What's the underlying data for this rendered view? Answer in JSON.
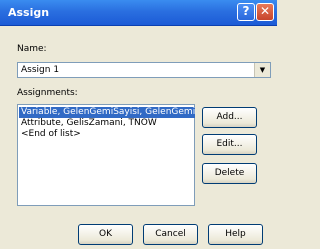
{
  "window": {
    "title": "Assign",
    "help_glyph": "?",
    "close_glyph": "✕"
  },
  "name_field": {
    "label": "Name:",
    "value": "Assign 1",
    "dropdown_glyph": "▼"
  },
  "assignments": {
    "label": "Assignments:",
    "items": [
      "Variable, GelenGemiSayisi, GelenGemiSayis",
      "Attribute, GelisZamani, TNOW",
      "<End of list>"
    ],
    "selected_index": 0
  },
  "side_buttons": {
    "add": "Add...",
    "edit": "Edit...",
    "delete": "Delete"
  },
  "footer_buttons": {
    "ok": "OK",
    "cancel": "Cancel",
    "help": "Help"
  },
  "colors": {
    "title_bar": "#2a6fe0",
    "selection": "#316ac5",
    "dialog_bg": "#ece9d8"
  }
}
